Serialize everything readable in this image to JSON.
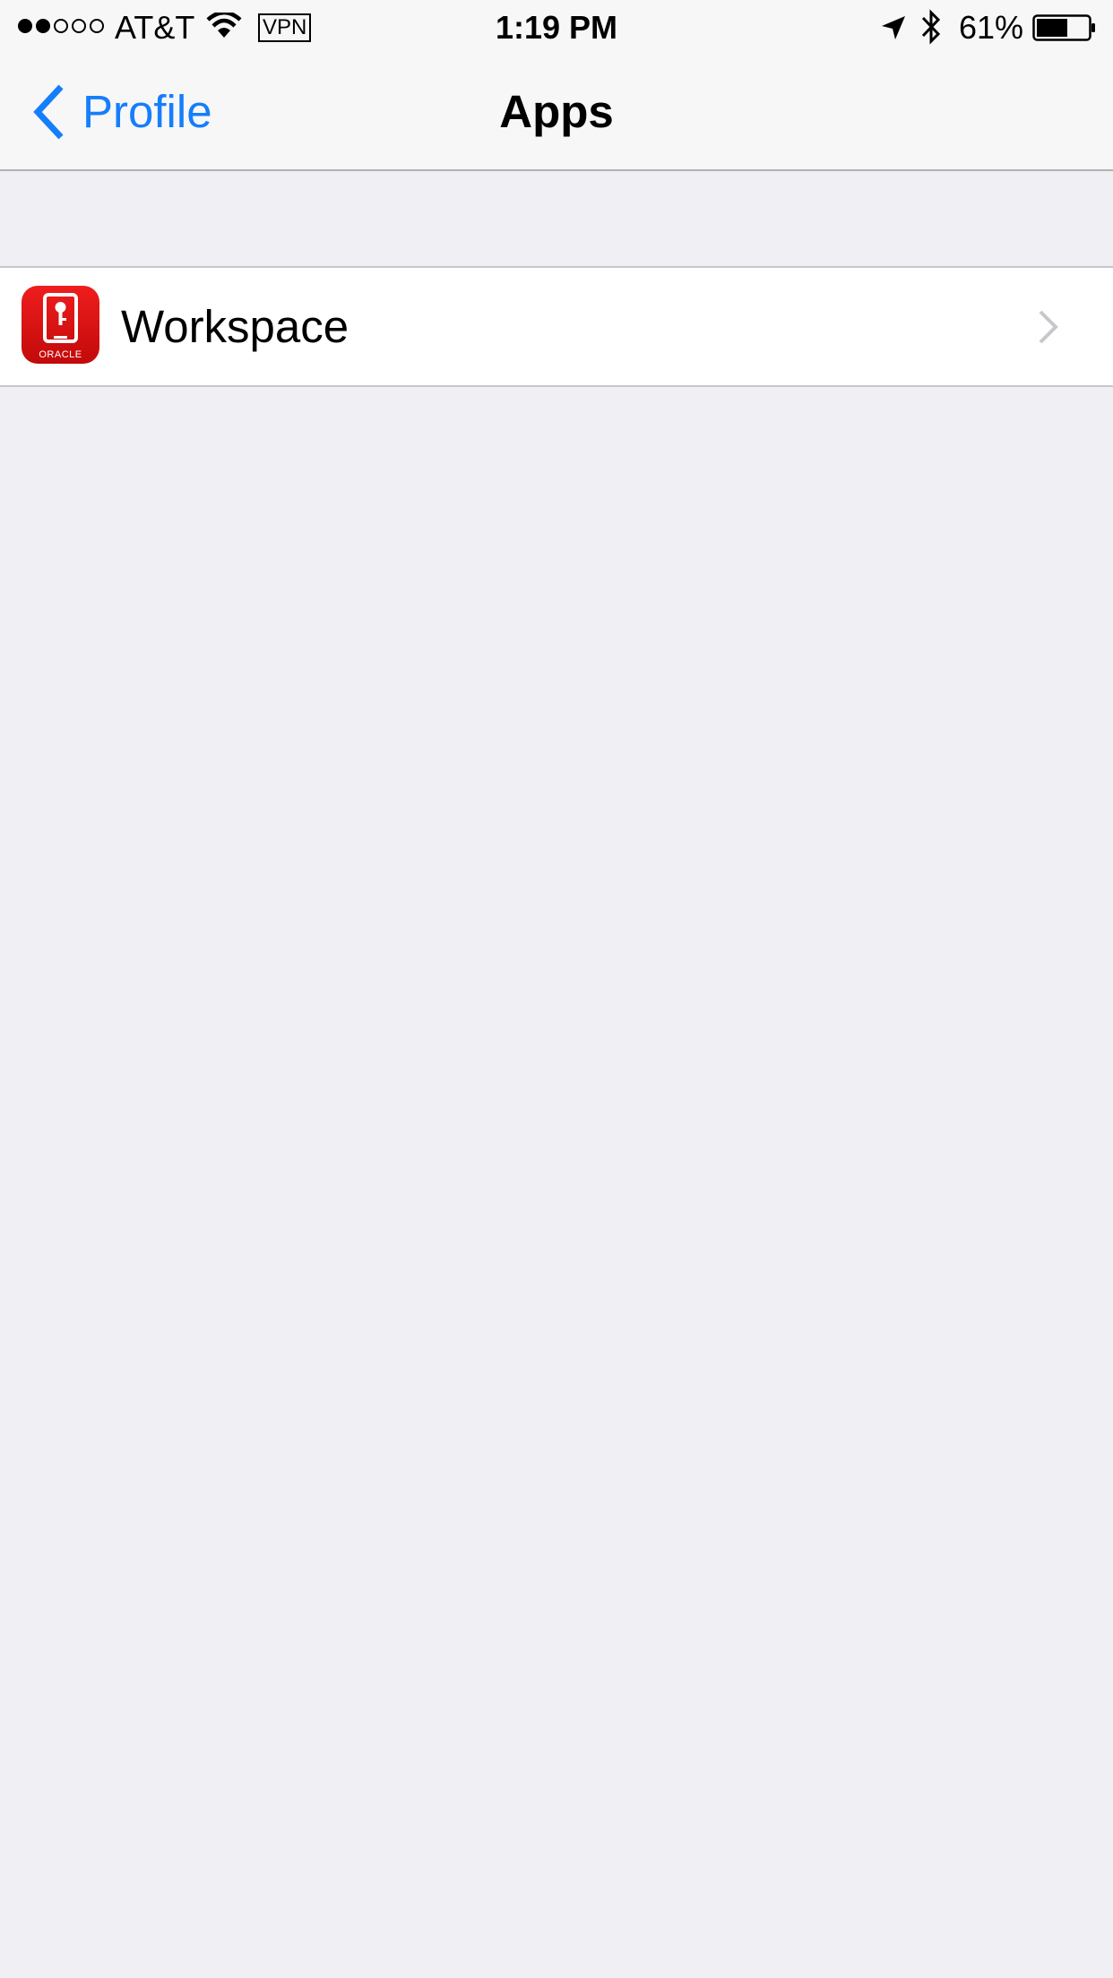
{
  "status_bar": {
    "signal": {
      "filled": 2,
      "total": 5
    },
    "carrier": "AT&T",
    "wifi_icon": "wifi-icon",
    "vpn": "VPN",
    "time": "1:19 PM",
    "location_icon": "location-arrow-icon",
    "bluetooth_icon": "bluetooth-icon",
    "battery_percent": "61%",
    "battery_level": 0.61
  },
  "nav": {
    "back_label": "Profile",
    "title": "Apps"
  },
  "apps": [
    {
      "name": "Workspace",
      "icon": "oracle-workspace-app-icon",
      "icon_text": "ORACLE"
    }
  ],
  "colors": {
    "accent": "#157efb",
    "background": "#efeff4",
    "app_icon_red": "#e20f0f"
  }
}
